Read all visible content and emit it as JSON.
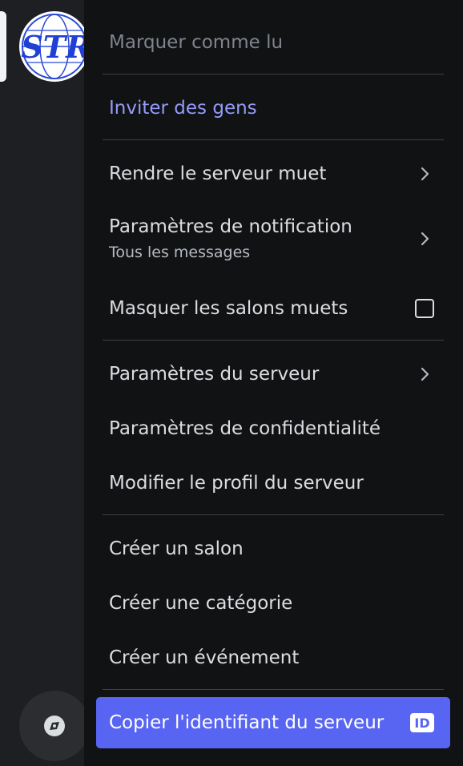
{
  "server": {
    "icon_text": "STR"
  },
  "menu": {
    "mark_read": "Marquer comme lu",
    "invite": "Inviter des gens",
    "mute_server": "Rendre le serveur muet",
    "notification_settings": "Paramètres de notification",
    "notification_sub": "Tous les messages",
    "hide_muted": "Masquer les salons muets",
    "server_settings": "Paramètres du serveur",
    "privacy_settings": "Paramètres de confidentialité",
    "edit_profile": "Modifier le profil du serveur",
    "create_channel": "Créer un salon",
    "create_category": "Créer une catégorie",
    "create_event": "Créer un événement",
    "copy_id": "Copier l'identifiant du serveur",
    "id_badge": "ID"
  },
  "colors": {
    "menu_bg": "#111214",
    "accent": "#949cf7",
    "brand": "#5865f2",
    "muted": "#80848e"
  }
}
